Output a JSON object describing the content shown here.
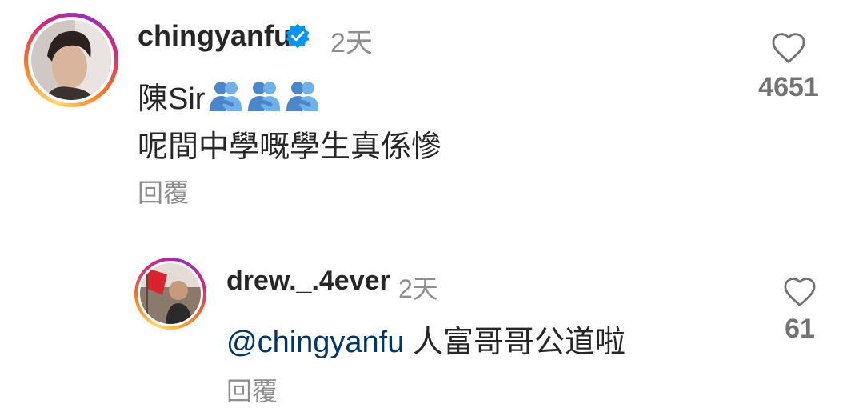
{
  "comments": [
    {
      "username": "chingyanfu",
      "verified": true,
      "time": "2天",
      "text_line1": "陳Sir",
      "text_line1_emojis": [
        "people-hugging-emoji",
        "people-hugging-emoji",
        "people-hugging-emoji"
      ],
      "text_line2": "呢間中學嘅學生真係慘",
      "reply_label": "回覆",
      "like_count": "4651"
    },
    {
      "username": "drew._.4ever",
      "verified": false,
      "time": "2天",
      "mention": "@chingyanfu",
      "text": " 人富哥哥公道啦",
      "reply_label": "回覆",
      "like_count": "61"
    }
  ],
  "colors": {
    "text": "#262626",
    "secondary": "#8e8e8e",
    "mention": "#00376b",
    "verified": "#0095f6"
  }
}
